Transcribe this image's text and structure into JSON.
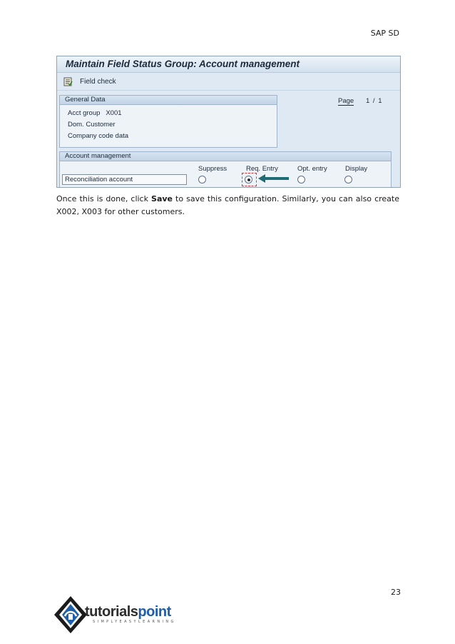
{
  "header": {
    "title": "SAP SD"
  },
  "sap_window": {
    "title": "Maintain Field Status Group: Account management",
    "toolbar": {
      "field_check": "Field check",
      "icon": "field-check-icon"
    },
    "general_data": {
      "heading": "General Data",
      "acct_group_label": "Acct group",
      "acct_group_value": "X001",
      "line2": "Dom. Customer",
      "line3": "Company code data"
    },
    "page": {
      "label": "Page",
      "value": "1 / 1"
    },
    "account_management": {
      "heading": "Account management",
      "columns": [
        "Suppress",
        "Req. Entry",
        "Opt. entry",
        "Display"
      ],
      "field": "Reconciliation account",
      "selected": "Req. Entry"
    },
    "colors": {
      "window_bg": "#dfe9f3",
      "focus": "#d23b3b",
      "arrow": "#1f6b73"
    }
  },
  "body": {
    "para_1": "Once this is done, click ",
    "para_bold": "Save",
    "para_2": " to save this configuration. Similarly, you can also create X002, X003 for other customers."
  },
  "footer": {
    "page_number": "23",
    "logo_name_a": "tutorials",
    "logo_name_b": "point",
    "logo_tagline": "SIMPLYEASYLEARNING"
  }
}
